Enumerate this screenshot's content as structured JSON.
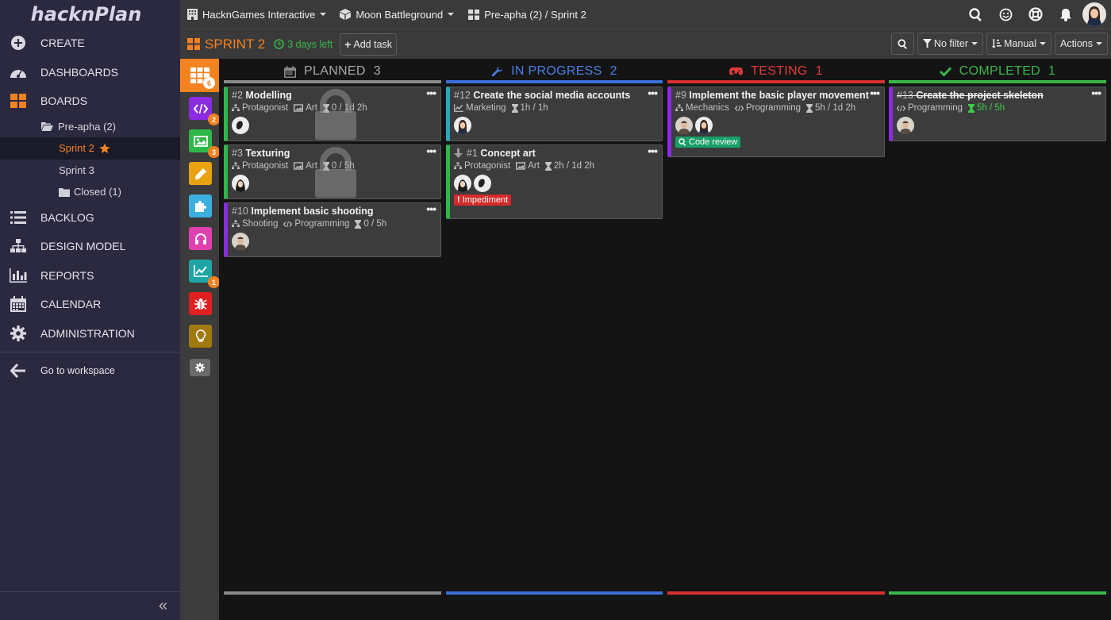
{
  "app": {
    "logo": "hacknPlan"
  },
  "sidebar": {
    "create": "CREATE",
    "dashboards": "DASHBOARDS",
    "boards": "BOARDS",
    "folder": "Pre-apha (2)",
    "sprint2": "Sprint 2",
    "sprint3": "Sprint 3",
    "closed": "Closed (1)",
    "backlog": "BACKLOG",
    "design_model": "DESIGN MODEL",
    "reports": "REPORTS",
    "calendar": "CALENDAR",
    "administration": "ADMINISTRATION",
    "workspace": "Go to workspace",
    "collapse": "«"
  },
  "topbar": {
    "workspace": "HacknGames Interactive",
    "project": "Moon Battleground",
    "breadcrumb": "Pre-apha (2) / Sprint 2"
  },
  "sprintbar": {
    "title": "SPRINT 2",
    "days_left": "3 days left",
    "add_task": "Add task",
    "filter": "No filter",
    "sort": "Manual",
    "actions": "Actions"
  },
  "toolstrip": {
    "badges": {
      "all": "6",
      "code": "2",
      "art": "3",
      "reports": "1"
    }
  },
  "colors": {
    "accent": "#f58220",
    "planned": "#8a8a8a",
    "in_progress": "#3b6fd8",
    "testing": "#d93030",
    "completed": "#3bb54a",
    "code": "#8a2be2",
    "art": "#2eb84a",
    "marketing": "#2aa7b8"
  },
  "columns": [
    {
      "name": "PLANNED",
      "count": "3"
    },
    {
      "name": "IN PROGRESS",
      "count": "2"
    },
    {
      "name": "TESTING",
      "count": "1"
    },
    {
      "name": "COMPLETED",
      "count": "1"
    }
  ],
  "cards": {
    "c2": {
      "num": "#2",
      "title": "Modelling",
      "cat": "Protagonist",
      "disc": "Art",
      "est": "0 / 1d 2h"
    },
    "c3": {
      "num": "#3",
      "title": "Texturing",
      "cat": "Protagonist",
      "disc": "Art",
      "est": "0 / 5h"
    },
    "c10": {
      "num": "#10",
      "title": "Implement basic shooting",
      "cat": "Shooting",
      "disc": "Programming",
      "est": "0 / 5h"
    },
    "c12": {
      "num": "#12",
      "title": "Create the social media accounts",
      "cat": "Marketing",
      "est": "1h / 1h"
    },
    "c1": {
      "num": "#1",
      "title": "Concept art",
      "cat": "Protagonist",
      "disc": "Art",
      "est": "2h / 1d 2h",
      "tag": "Impediment"
    },
    "c9": {
      "num": "#9",
      "title": "Implement the basic player movement",
      "cat": "Mechanics",
      "disc": "Programming",
      "est": "5h / 1d 2h",
      "tag": "Code review"
    },
    "c13": {
      "num": "#13",
      "title": "Create the project skeleton",
      "disc": "Programming",
      "est": "5h / 5h"
    }
  },
  "menu_dots": "•••"
}
